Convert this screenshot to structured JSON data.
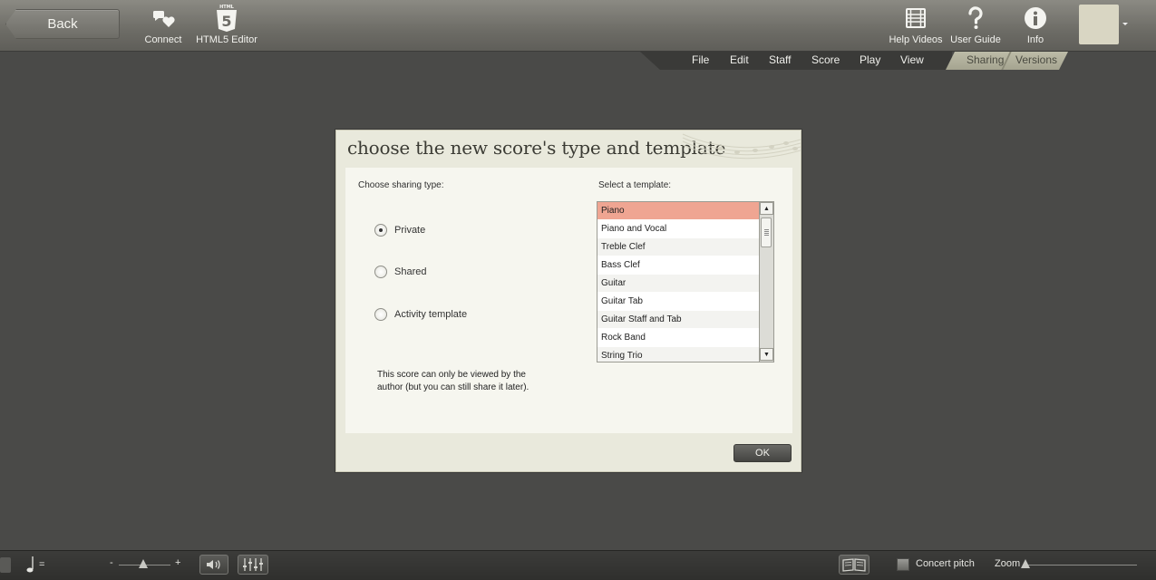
{
  "topbar": {
    "back_label": "Back",
    "tools": [
      {
        "name": "connect-button",
        "icon": "connect-icon",
        "label": "Connect"
      },
      {
        "name": "html5-editor-button",
        "icon": "html5-icon",
        "label": "HTML5 Editor"
      },
      {
        "name": "help-videos-button",
        "icon": "film-icon",
        "label": "Help Videos"
      },
      {
        "name": "user-guide-button",
        "icon": "question-icon",
        "label": "User Guide"
      },
      {
        "name": "info-button",
        "icon": "info-icon",
        "label": "Info"
      }
    ],
    "html5_badge_top": "HTML",
    "html5_badge_digit": "5"
  },
  "menu": {
    "items": [
      "File",
      "Edit",
      "Staff",
      "Score",
      "Play",
      "View"
    ],
    "tabs": [
      "Sharing",
      "Versions"
    ]
  },
  "dialog": {
    "title": "choose the new score's type and template",
    "sharing_label": "Choose sharing type:",
    "template_label": "Select a template:",
    "radios": [
      {
        "label": "Private",
        "checked": true
      },
      {
        "label": "Shared",
        "checked": false
      },
      {
        "label": "Activity template",
        "checked": false
      }
    ],
    "description": "This score can only be viewed by the author (but you can still share it later).",
    "templates": [
      "Piano",
      "Piano and Vocal",
      "Treble Clef",
      "Bass Clef",
      "Guitar",
      "Guitar Tab",
      "Guitar Staff and Tab",
      "Rock Band",
      "String Trio"
    ],
    "selected_template": "Piano",
    "ok_label": "OK"
  },
  "bottombar": {
    "tempo_equals": "=",
    "volume_minus": "-",
    "volume_plus": "+",
    "concert_pitch_label": "Concert pitch",
    "concert_pitch_checked": false,
    "zoom_label": "Zoom"
  },
  "colors": {
    "selected_row": "#efa592",
    "dialog_bg": "#e9e9dc",
    "topbar": "#6d6c66"
  }
}
